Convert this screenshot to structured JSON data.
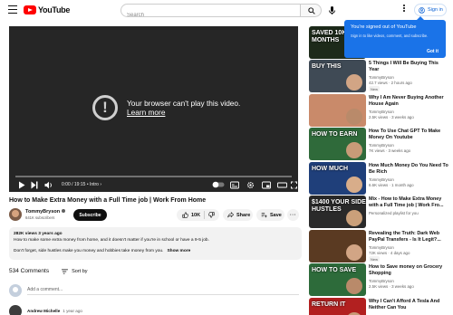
{
  "header": {
    "logo_text": "YouTube",
    "search_placeholder": "Search",
    "signin_label": "Sign in"
  },
  "tooltip": {
    "title": "You're signed out of YouTube",
    "body": "Sign in to like videos, comment, and subscribe.",
    "button": "Got it"
  },
  "player": {
    "error_line1": "Your browser can't play this video.",
    "error_link": "Learn more",
    "time": "0:00 / 19:15",
    "chapter": "Intro",
    "progress": 0
  },
  "video": {
    "title": "How to Make Extra Money with a Full Time job | Work From Home",
    "channel": "TommyBryson",
    "subscribers": "641K subscribers",
    "subscribe_label": "Subscribe",
    "likes": "10K",
    "share_label": "Share",
    "save_label": "Save"
  },
  "description": {
    "stats": "282K views  3 years ago",
    "line1": "How to make some extra money from home, and it doesn't matter if you're in school or have a 9-5 job.",
    "line2": "Don't forget, side hustles make you money and hobbies take money from you.",
    "more_label": "Show more"
  },
  "comments": {
    "count_label": "534 Comments",
    "sort_label": "Sort by",
    "add_placeholder": "Add a comment...",
    "first_author": "Andrew Michelle",
    "first_time": "1 year ago"
  },
  "recommendations": [
    {
      "title": "",
      "channel": "",
      "meta": "",
      "badge": "",
      "thumb_text": "SAVED 10K IN 6 MONTHS",
      "thumb_color": "#1d2a1a"
    },
    {
      "title": "5 Things I Will Be Buying This Year",
      "channel": "TommyBryson",
      "meta": "42.7 views  ·  2 hours ago",
      "badge": "New",
      "thumb_text": "BUY THIS",
      "thumb_color": "#3f4a55"
    },
    {
      "title": "Why I Am Never Buying Another House Again",
      "channel": "TommyBryson",
      "meta": "2.5K views  ·  3 weeks ago",
      "badge": "",
      "thumb_text": "",
      "thumb_color": "#c98a6a"
    },
    {
      "title": "How To Use Chat GPT To Make Money On Youtube",
      "channel": "TommyBryson",
      "meta": "7K views  ·  3 weeks ago",
      "badge": "",
      "thumb_text": "HOW TO EARN",
      "thumb_color": "#2f6a3a"
    },
    {
      "title": "How Much Money Do You Need To Be Rich",
      "channel": "TommyBryson",
      "meta": "6.6K views  ·  1 month ago",
      "badge": "",
      "thumb_text": "HOW MUCH",
      "thumb_color": "#1f3f7a"
    },
    {
      "title": "Mix - How to Make Extra Money with a Full Time job | Work Fro...",
      "channel": "Personalized playlist for you",
      "meta": "",
      "badge": "",
      "thumb_text": "$1400 YOUR SIDE HUSTLES",
      "thumb_color": "#2a2a2a"
    },
    {
      "title": "Revealing the Truth: Dark Web PayPal Transfers - Is It Legit?...",
      "channel": "TommyBryson",
      "meta": "72K views  ·  4 days ago",
      "badge": "New",
      "thumb_text": "",
      "thumb_color": "#5a3a22"
    },
    {
      "title": "How to Save money on Grocery Shopping",
      "channel": "TommyBryson",
      "meta": "2.5K views  ·  3 weeks ago",
      "badge": "",
      "thumb_text": "HOW TO SAVE",
      "thumb_color": "#2d6b3a"
    },
    {
      "title": "Why I Can't Afford A Tesla And Neither Can You",
      "channel": "",
      "meta": "",
      "badge": "",
      "thumb_text": "RETURN IT",
      "thumb_color": "#b22020"
    }
  ]
}
